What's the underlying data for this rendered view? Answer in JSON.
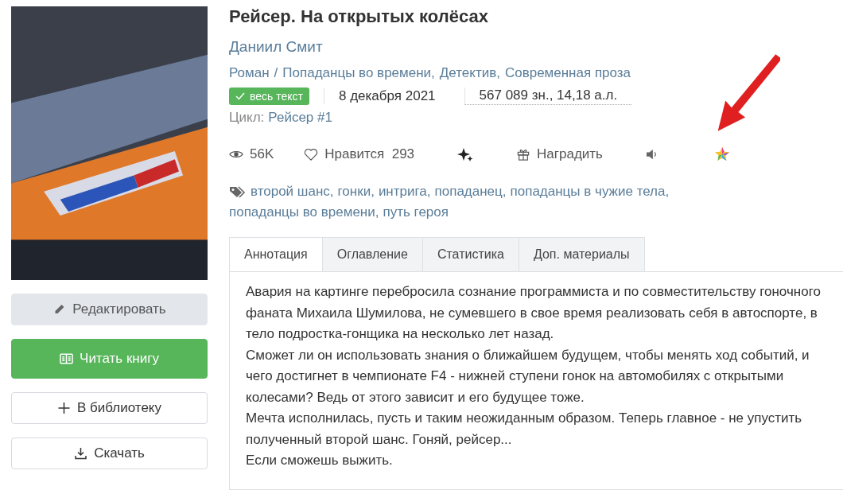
{
  "book": {
    "title": "Рейсер. На открытых колёсах",
    "author": "Даниил Смит",
    "genre_form": "Роман",
    "genre_separator": "/",
    "genres": [
      "Попаданцы во времени,",
      "Детектив,",
      "Современная проза"
    ],
    "status_badge": "весь текст",
    "date": "8 декабря 2021",
    "size": "567 089 зн., 14,18 а.л.",
    "cycle_label": "Цикл:",
    "cycle": "Рейсер #1"
  },
  "stats": [
    {
      "kind": "views",
      "label": "56K"
    },
    {
      "kind": "likes",
      "label": "Нравится",
      "count": "293"
    },
    {
      "kind": "sparkle"
    },
    {
      "kind": "award",
      "label": "Наградить"
    },
    {
      "kind": "audio"
    },
    {
      "kind": "star"
    }
  ],
  "tags": [
    "второй шанс,",
    "гонки,",
    "интрига,",
    "попаданец,",
    "попаданцы в чужие тела,",
    "попаданцы во времени,",
    "путь героя"
  ],
  "buttons": [
    {
      "kind": "edit",
      "label": "Редактировать"
    },
    {
      "kind": "read",
      "label": "Читать книгу"
    },
    {
      "kind": "add",
      "label": "В библиотеку"
    },
    {
      "kind": "download",
      "label": "Скачать"
    }
  ],
  "tabs": [
    {
      "label": "Аннотация",
      "selected": true
    },
    {
      "label": "Оглавление",
      "selected": false
    },
    {
      "label": "Статистика",
      "selected": false
    },
    {
      "label": "Доп. материалы",
      "selected": false
    }
  ],
  "annotation": [
    "Авария на картинге перебросила сознание программиста и по совместительству гоночного фаната Михаила Шумилова, не сумевшего в свое время реализовать себя в автоспорте, в тело подростка-гонщика на несколько лет назад.",
    "Сможет ли он использовать знания о ближайшем будущем, чтобы менять ход событий, и чего достигнет в чемпионате F4 - нижней ступени гонок на автомобилях с открытыми колесами? Ведь от этого зависит и его будущее тоже.",
    "Мечта исполнилась, пусть и таким неожиданным образом. Теперь главное - не упустить полученный второй шанс. Гоняй, рейсер...",
    "Если сможешь выжить."
  ]
}
